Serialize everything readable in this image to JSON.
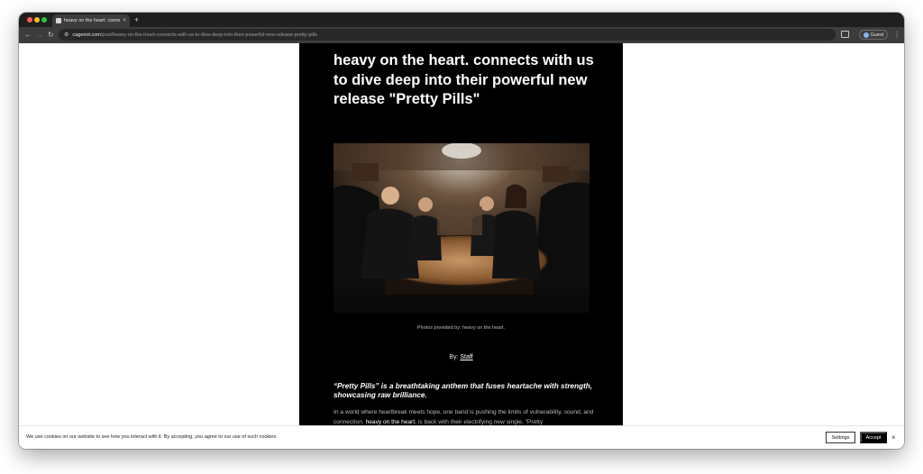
{
  "browser": {
    "tab_title": "heavy on the heart. connects",
    "tab_close": "×",
    "new_tab": "+",
    "url_host": "cageriot.com",
    "url_path": "/post/heavy-on-the-heart-connects-with-us-to-dive-deep-into-their-powerful-new-release-pretty-pills",
    "profile_label": "Guest"
  },
  "article": {
    "headline": "heavy on the heart. connects with us to dive deep into their powerful new release \"Pretty Pills\"",
    "photo_caption": "Photos provided by: heavy on the heart.",
    "byline_prefix": "By: ",
    "byline_author": "Staff",
    "lede": "“Pretty Pills” is a breathtaking anthem that fuses heartache with strength, showcasing raw brilliance.",
    "body_part1": "In a world where heartbreak meets hope, one band is pushing the limits of vulnerability, sound, and connection. ",
    "body_band": "heavy on the heart.",
    "body_part2": " is back with their electrifying new single, \"Pretty"
  },
  "cookie": {
    "message": "We use cookies on our website to see how you interact with it. By accepting, you agree to our use of such cookies.",
    "settings_label": "Settings",
    "accept_label": "Accept",
    "close_label": "×"
  },
  "colors": {
    "article_bg": "#000000",
    "page_bg": "#ffffff",
    "browser_chrome": "#1f1f1f"
  }
}
